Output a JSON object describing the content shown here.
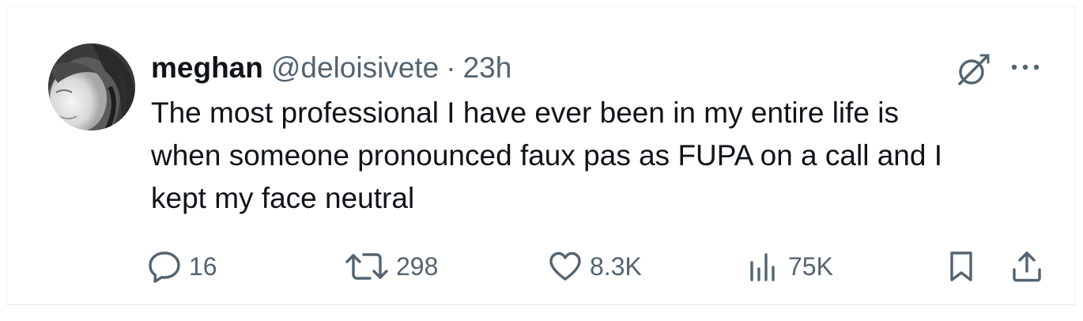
{
  "tweet": {
    "author": {
      "display_name": "meghan",
      "handle": "@deloisivete"
    },
    "separator": "·",
    "timestamp": "23h",
    "text": "The most professional I have ever been in my entire life is\nwhen someone pronounced faux pas as FUPA on a call and I\nkept my face neutral"
  },
  "actions": {
    "replies": "16",
    "reposts": "298",
    "likes": "8.3K",
    "views": "75K"
  },
  "icons": {
    "header": [
      "grok-icon",
      "more-icon"
    ],
    "actions": [
      "reply-icon",
      "repost-icon",
      "like-icon",
      "views-icon",
      "bookmark-icon",
      "share-icon"
    ]
  },
  "colors": {
    "text_primary": "#0f1419",
    "text_secondary": "#536471",
    "border": "#eff3f4"
  }
}
